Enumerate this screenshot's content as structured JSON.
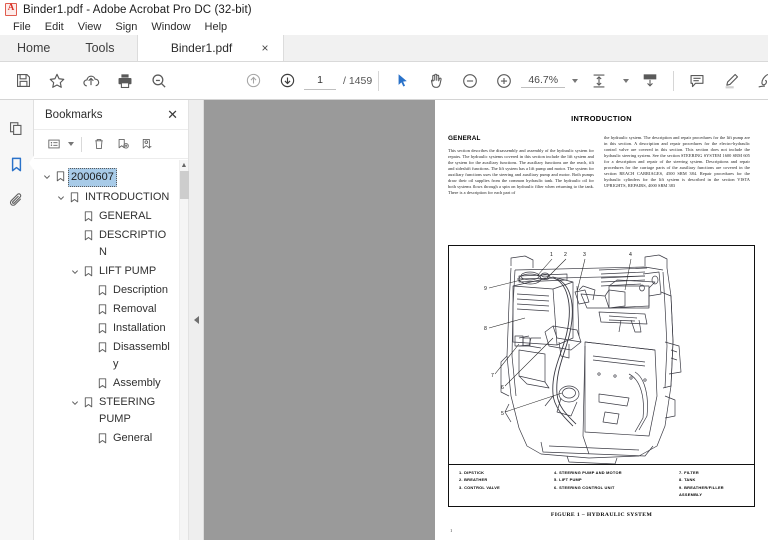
{
  "window": {
    "title": "Binder1.pdf - Adobe Acrobat Pro DC (32-bit)",
    "app_icon": "acrobat-icon"
  },
  "menubar": {
    "items": [
      {
        "label": "File"
      },
      {
        "label": "Edit"
      },
      {
        "label": "View"
      },
      {
        "label": "Sign"
      },
      {
        "label": "Window"
      },
      {
        "label": "Help"
      }
    ]
  },
  "tabbar": {
    "home_label": "Home",
    "tools_label": "Tools",
    "document_tab": {
      "label": "Binder1.pdf",
      "close_glyph": "×"
    }
  },
  "toolbar": {
    "save_icon": "save-icon",
    "star_icon": "add-to-favorites-icon",
    "upload_icon": "upload-to-cloud-icon",
    "print_icon": "print-icon",
    "search_icon": "search-icon",
    "prev_page_icon": "previous-page-icon",
    "next_page_icon": "next-page-icon",
    "page_number": "1",
    "page_total": "/  1459",
    "select_tool_icon": "select-cursor-icon",
    "hand_tool_icon": "hand-pan-icon",
    "zoom_out_icon": "zoom-out-icon",
    "zoom_in_icon": "zoom-in-icon",
    "zoom_level": "46.7%",
    "fit_page_icon": "fit-page-icon",
    "scroll_mode_icon": "page-display-icon",
    "comment_icon": "add-comment-icon",
    "highlight_icon": "highlight-text-icon",
    "draw_icon": "draw-freehand-icon"
  },
  "rail": {
    "page_thumbnails_icon": "page-thumbnails-icon",
    "bookmarks_icon": "bookmarks-icon",
    "attachments_icon": "attachments-paperclip-icon"
  },
  "bookmarks_panel": {
    "title": "Bookmarks",
    "close_glyph": "✕",
    "options_icon": "bookmark-options-list-icon",
    "delete_icon": "delete-bookmark-trash-icon",
    "new_bookmark_icon": "new-bookmark-icon",
    "edit_bookmark_icon": "edit-bookmark-icon",
    "tree": [
      {
        "label": "2000607",
        "level": 0,
        "expandable": true,
        "expanded": true,
        "selected": true
      },
      {
        "label": "INTRODUCTION",
        "level": 1,
        "expandable": true,
        "expanded": true,
        "selected": false
      },
      {
        "label": "GENERAL",
        "level": 2,
        "expandable": false,
        "expanded": false,
        "selected": false
      },
      {
        "label": "DESCRIPTION",
        "level": 2,
        "expandable": false,
        "expanded": false,
        "selected": false
      },
      {
        "label": "LIFT PUMP",
        "level": 2,
        "expandable": true,
        "expanded": true,
        "selected": false
      },
      {
        "label": "Description",
        "level": 3,
        "expandable": false,
        "expanded": false,
        "selected": false
      },
      {
        "label": "Removal",
        "level": 3,
        "expandable": false,
        "expanded": false,
        "selected": false
      },
      {
        "label": "Installation",
        "level": 3,
        "expandable": false,
        "expanded": false,
        "selected": false
      },
      {
        "label": "Disassembly",
        "level": 3,
        "expandable": false,
        "expanded": false,
        "selected": false
      },
      {
        "label": "Assembly",
        "level": 3,
        "expandable": false,
        "expanded": false,
        "selected": false
      },
      {
        "label": "STEERING PUMP",
        "level": 2,
        "expandable": true,
        "expanded": true,
        "selected": false
      },
      {
        "label": "General",
        "level": 3,
        "expandable": false,
        "expanded": false,
        "selected": false
      }
    ]
  },
  "splitter": {
    "collapse_glyph": "◀"
  },
  "document": {
    "title": "INTRODUCTION",
    "left_column": {
      "heading": "GENERAL",
      "paragraph": "This section describes the disassembly and assembly of the hydraulic system for repairs. The hydraulic systems covered in this section include the lift system and the system for the auxiliary functions. The auxiliary functions are the reach, tilt and sideshift functions. The lift system has a lift pump and motor. The system for auxiliary functions uses the steering and auxiliary pump and motor. Both pumps draw their oil supplies from the common hydraulic tank. The hydraulic oil for both systems flows through a spin on hydraulic filter when returning to the tank. There is a description for each part of"
    },
    "right_column": {
      "paragraph": "the hydraulic system. The description and repair procedures for the lift pump are in this section. A description and repair procedures for the electro-hydraulic control valve are covered in this section. This section does not include the hydraulic steering system. See the section STEERING SYSTEM 1600 SRM 605 for a description and repair of the steering system. Descriptions and repair procedures for the carriage parts of the auxiliary functions are covered in the section REACH CARRIAGES, 4500 SRM 384. Repair procedures for the hydraulic cylinders for the lift system is described in the section VISTA UPRIGHTS, REPAIRS, 4000 SRM 383"
    },
    "figure": {
      "caption": "FIGURE 1 – HYDRAULIC SYSTEM",
      "callouts": [
        "1",
        "2",
        "3",
        "4",
        "5",
        "6",
        "7",
        "8",
        "9"
      ],
      "legend_col1": [
        "1.  DIPSTICK",
        "2.  BREATHER",
        "3.  CONTROL VALVE"
      ],
      "legend_col2": [
        "4.  STEERING PUMP AND MOTOR",
        "5.  LIFT PUMP",
        "6.  STEERING CONTROL UNIT"
      ],
      "legend_col3": [
        "7.  FILTER",
        "8.  TANK",
        "9.  BREATHER/FILLER ASSEMBLY"
      ]
    },
    "folio": "1"
  },
  "colors": {
    "accent": "#2a72c9",
    "selection": "#a8cbe8",
    "viewport_gray": "#9a9a9a",
    "tabbar_gray": "#f1f1f1"
  }
}
